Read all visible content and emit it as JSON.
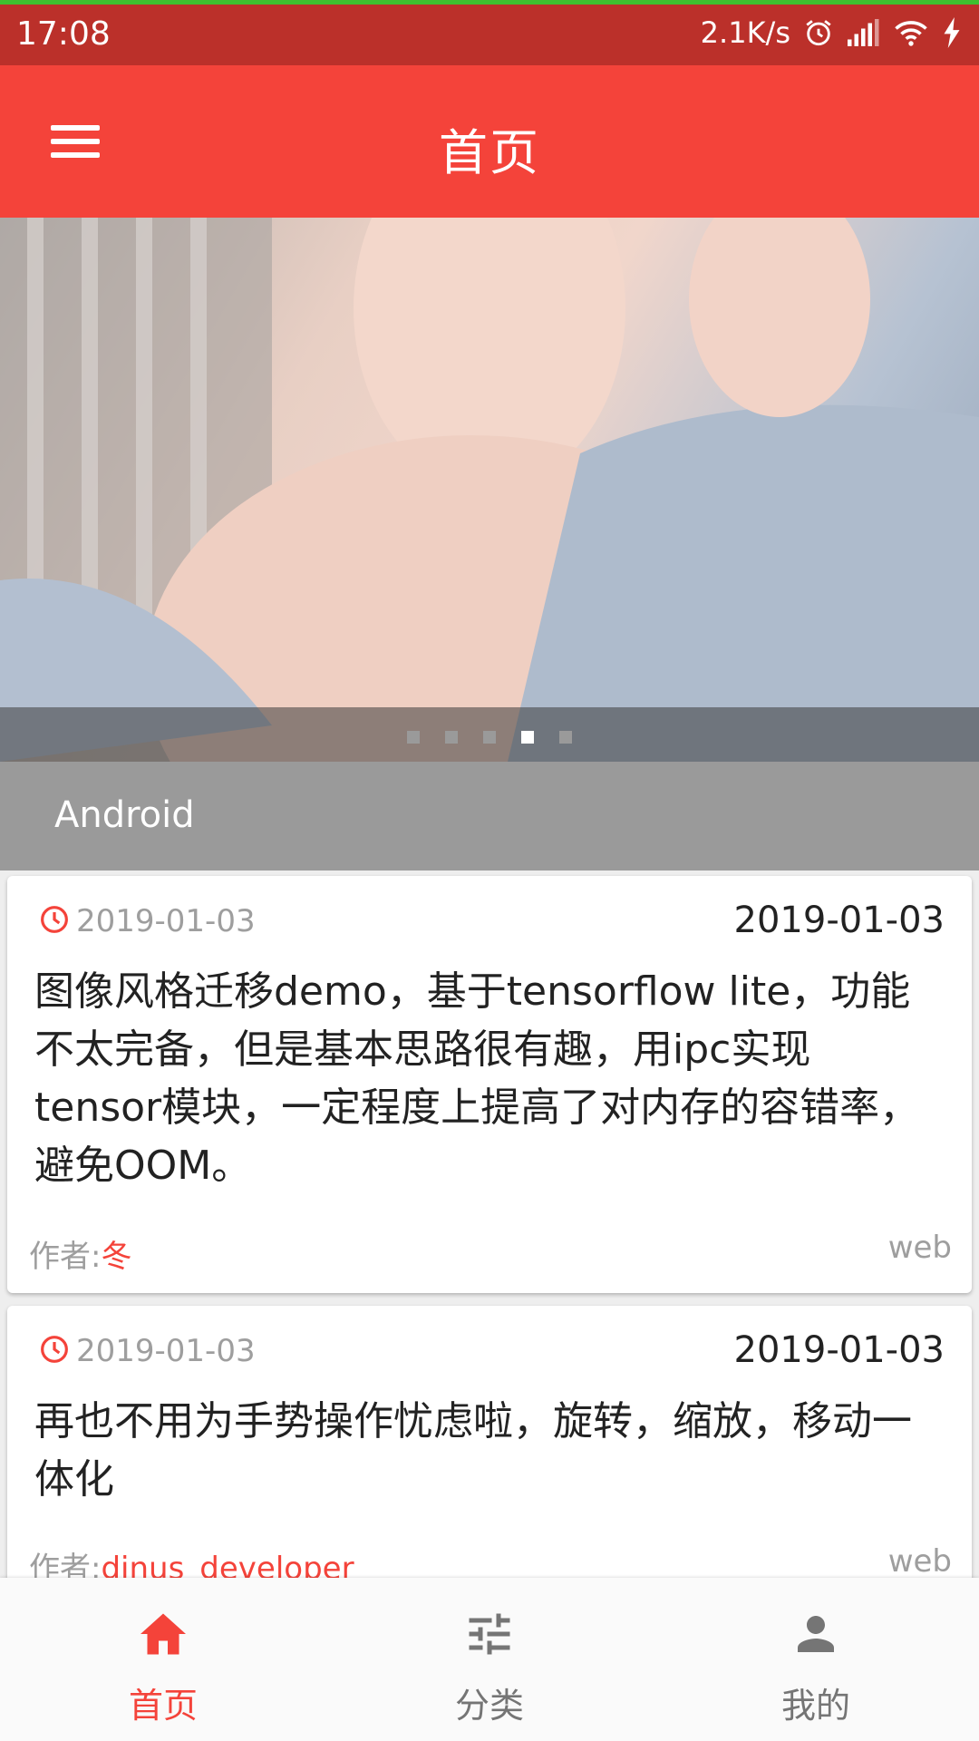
{
  "status_bar": {
    "time": "17:08",
    "speed": "2.1K/s"
  },
  "app_bar": {
    "title": "首页"
  },
  "banner": {
    "dots": [
      false,
      false,
      false,
      true,
      false
    ]
  },
  "category": {
    "label": "Android"
  },
  "articles": [
    {
      "date_left": "2019-01-03",
      "date_right": "2019-01-03",
      "desc": "图像风格迁移demo，基于tensorflow lite，功能不太完备，但是基本思路很有趣，用ipc实现tensor模块，一定程度上提高了对内存的容错率，避免OOM。",
      "author_label": "作者:",
      "author": "冬",
      "source": "web"
    },
    {
      "date_left": "2019-01-03",
      "date_right": "2019-01-03",
      "desc": "再也不用为手势操作忧虑啦，旋转，缩放，移动一体化",
      "author_label": "作者:",
      "author": "dinus_developer",
      "source": "web"
    }
  ],
  "bottom_nav": {
    "items": [
      {
        "label": "首页",
        "icon": "home-icon",
        "active": true
      },
      {
        "label": "分类",
        "icon": "sliders-icon",
        "active": false
      },
      {
        "label": "我的",
        "icon": "person-icon",
        "active": false
      }
    ],
    "active_color": "#f4433a",
    "inactive_color": "#757575"
  },
  "colors": {
    "primary": "#f4433a",
    "primary_dark": "#bb302a"
  }
}
